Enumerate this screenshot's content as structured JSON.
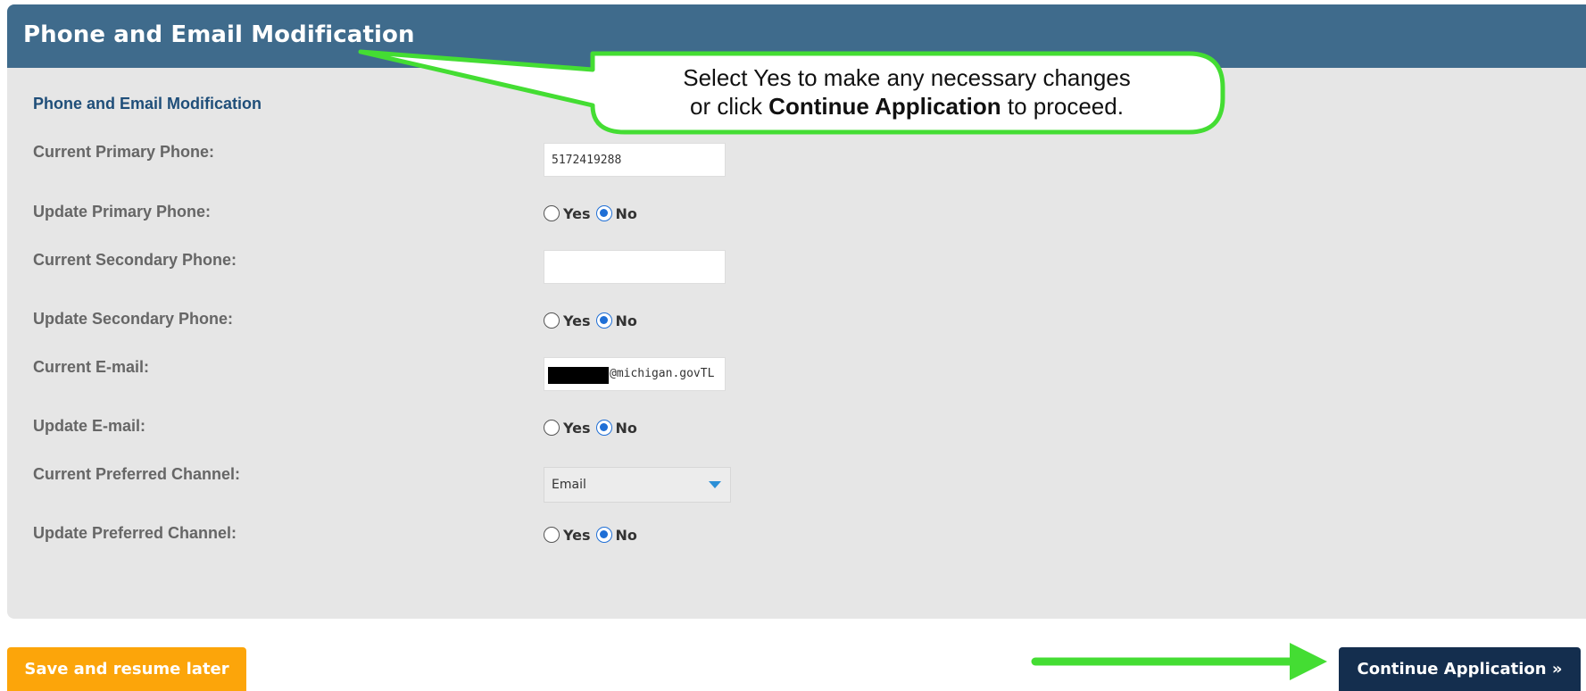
{
  "header": {
    "title": "Phone and Email Modification"
  },
  "section": {
    "title": "Phone and Email Modification"
  },
  "fields": {
    "current_primary_phone": {
      "label": "Current Primary Phone:",
      "value": "5172419288"
    },
    "update_primary_phone": {
      "label": "Update Primary Phone:",
      "selected": "No"
    },
    "current_secondary_phone": {
      "label": "Current Secondary Phone:",
      "value": ""
    },
    "update_secondary_phone": {
      "label": "Update Secondary Phone:",
      "selected": "No"
    },
    "current_email": {
      "label": "Current E-mail:",
      "value_visible": "@michigan.govTL"
    },
    "update_email": {
      "label": "Update E-mail:",
      "selected": "No"
    },
    "current_preferred_channel": {
      "label": "Current Preferred Channel:",
      "value": "Email"
    },
    "update_preferred_channel": {
      "label": "Update Preferred Channel:",
      "selected": "No"
    }
  },
  "radio_options": {
    "yes": "Yes",
    "no": "No"
  },
  "callout": {
    "line1": "Select Yes to make any necessary changes",
    "line2_prefix": "or click ",
    "line2_bold": "Continue Application",
    "line2_suffix": " to proceed."
  },
  "buttons": {
    "save": "Save and resume later",
    "continue": "Continue Application »"
  },
  "colors": {
    "header_bg": "#3f6b8c",
    "panel_bg": "#e6e6e6",
    "save_bg": "#fca50a",
    "continue_bg": "#142e4e",
    "annotation_green": "#44dd33",
    "radio_checked": "#1f6fd6"
  }
}
